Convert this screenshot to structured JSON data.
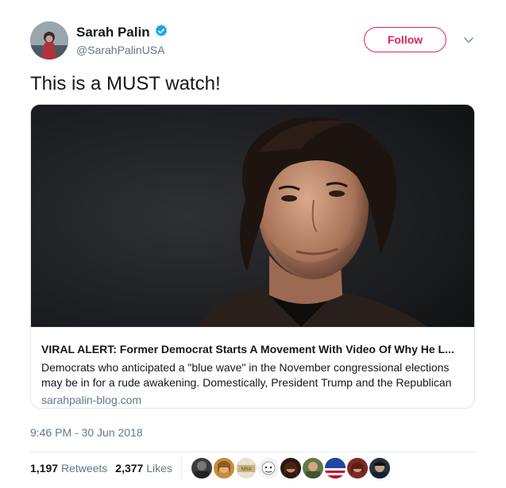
{
  "author": {
    "name": "Sarah Palin",
    "handle": "@SarahPalinUSA",
    "verified": true
  },
  "actions": {
    "follow_label": "Follow",
    "more_icon": "chevron-down-icon"
  },
  "tweet": {
    "text": "This is a MUST watch!",
    "timestamp": "9:46 PM - 30 Jun 2018"
  },
  "card": {
    "title": "VIRAL ALERT: Former Democrat Starts A Movement With Video Of Why He L...",
    "description": "Democrats who anticipated a \"blue wave\" in the November congressional elections may be in for a rude awakening. Domestically, President Trump and the Republican",
    "domain": "sarahpalin-blog.com"
  },
  "stats": {
    "retweets_count": "1,197",
    "retweets_label": "Retweets",
    "likes_count": "2,377",
    "likes_label": "Likes"
  },
  "colors": {
    "follow_accent": "#e0245e",
    "verified_blue": "#1da1f2",
    "secondary_text": "#657786"
  },
  "likers_count": 9
}
